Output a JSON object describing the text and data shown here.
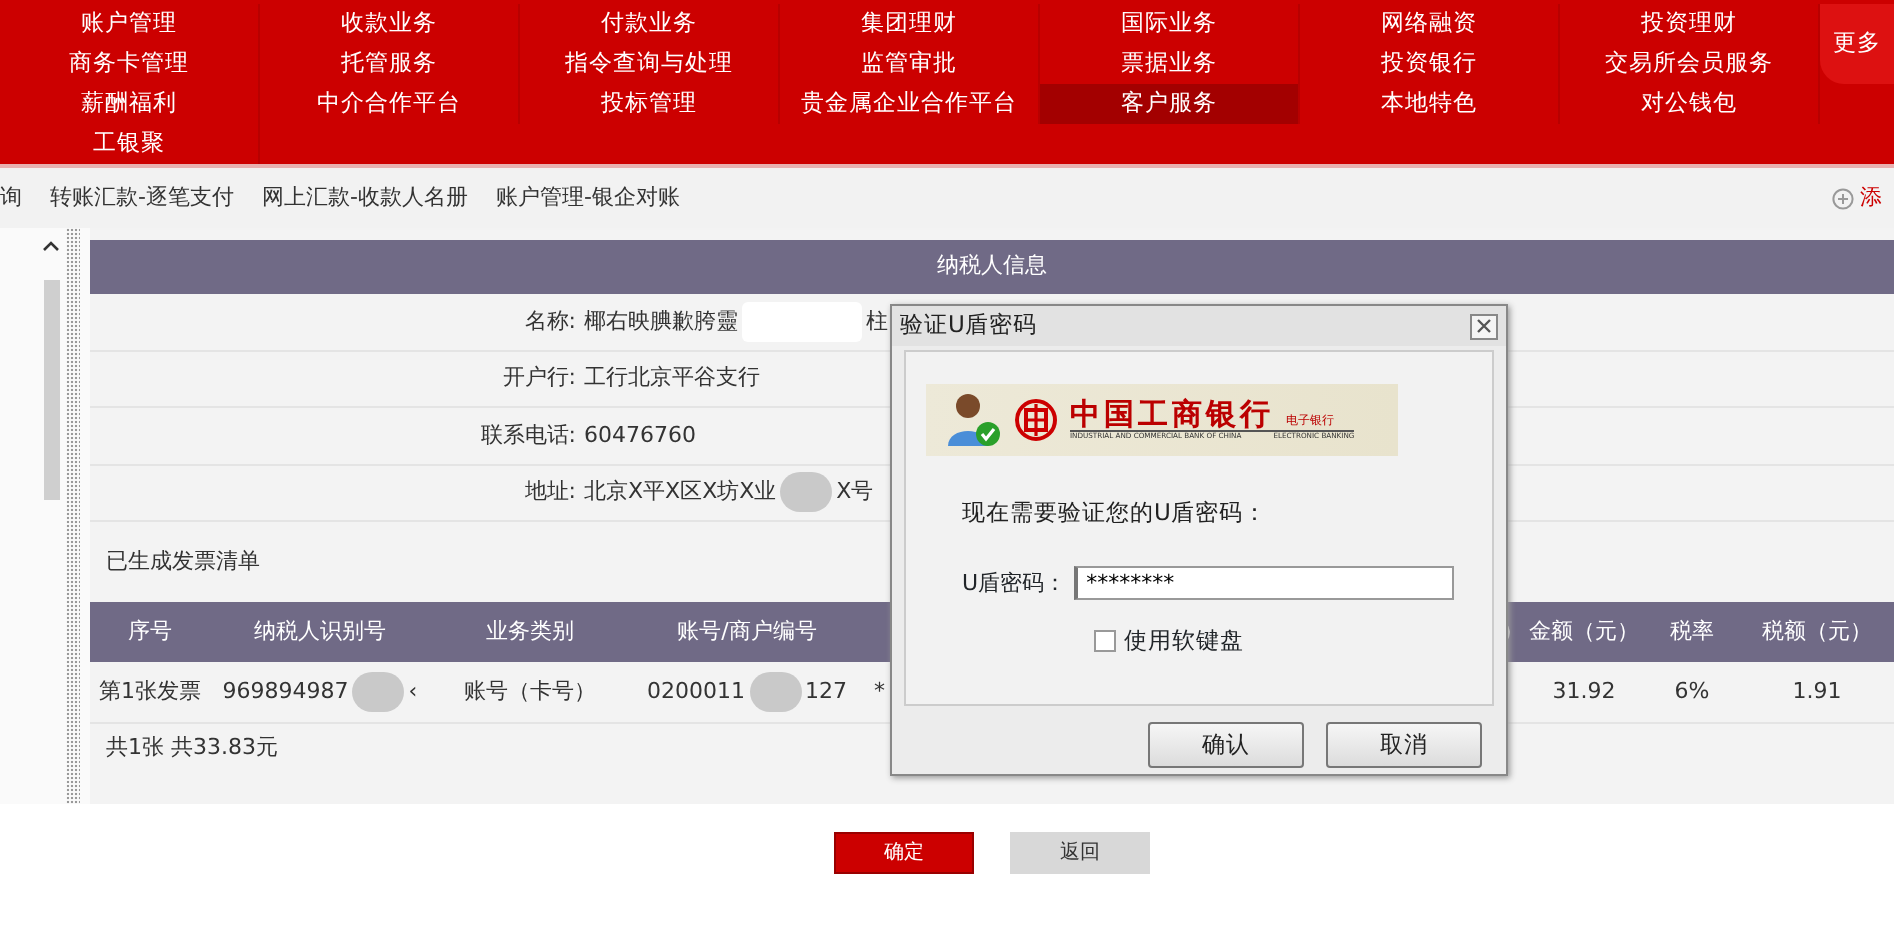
{
  "menu": {
    "items": [
      {
        "label": "账户管理",
        "selected": false
      },
      {
        "label": "收款业务",
        "selected": false
      },
      {
        "label": "付款业务",
        "selected": false
      },
      {
        "label": "集团理财",
        "selected": false
      },
      {
        "label": "国际业务",
        "selected": false
      },
      {
        "label": "网络融资",
        "selected": false
      },
      {
        "label": "投资理财",
        "selected": false
      },
      {
        "label": "商务卡管理",
        "selected": false
      },
      {
        "label": "托管服务",
        "selected": false
      },
      {
        "label": "指令查询与处理",
        "selected": false
      },
      {
        "label": "监管审批",
        "selected": false
      },
      {
        "label": "票据业务",
        "selected": false
      },
      {
        "label": "投资银行",
        "selected": false
      },
      {
        "label": "交易所会员服务",
        "selected": false
      },
      {
        "label": "薪酬福利",
        "selected": false
      },
      {
        "label": "中介合作平台",
        "selected": false
      },
      {
        "label": "投标管理",
        "selected": false
      },
      {
        "label": "贵金属企业合作平台",
        "selected": false
      },
      {
        "label": "客户服务",
        "selected": true
      },
      {
        "label": "本地特色",
        "selected": false
      },
      {
        "label": "对公钱包",
        "selected": false
      },
      {
        "label": "工银聚",
        "selected": false
      }
    ],
    "more": "更多"
  },
  "breadcrumbs": [
    "询",
    "转账汇款-逐笔支付",
    "网上汇款-收款人名册",
    "账户管理-银企对账"
  ],
  "add_link": "添",
  "taxpayer": {
    "title": "纳税人信息",
    "fields": [
      {
        "label": "名称:",
        "parts": [
          "椰右映腆歉胯靈",
          "柱"
        ]
      },
      {
        "label": "开户行:",
        "parts": [
          "工行北京平谷支行"
        ]
      },
      {
        "label": "联系电话:",
        "parts": [
          "60476760"
        ]
      },
      {
        "label": "地址:",
        "parts": [
          "北京X平X区X坊X业",
          "X号"
        ]
      }
    ]
  },
  "invoice_list": {
    "title": "已生成发票清单",
    "columns": [
      "序号",
      "纳税人识别号",
      "业务类别",
      "账号/商户编号",
      "",
      "）",
      "金额（元）",
      "税率",
      "税额（元）"
    ],
    "rows": [
      [
        [
          "第1张发票"
        ],
        [
          "969894987",
          "‹"
        ],
        [
          "账号（卡号）"
        ],
        [
          "0200011",
          "127"
        ],
        [
          "*"
        ],
        [
          ""
        ],
        [
          "31.92"
        ],
        [
          "6%"
        ],
        [
          "1.91"
        ]
      ]
    ],
    "total": "共1张 共33.83元"
  },
  "actions": {
    "confirm": "确定",
    "back": "返回"
  },
  "dialog": {
    "title": "验证U盾密码",
    "bank_name": "中国工商银行",
    "bank_tag": "电子银行",
    "bank_name_en": "INDUSTRIAL AND COMMERCIAL BANK OF CHINA",
    "bank_tag_en": "ELECTRONIC BANKING",
    "prompt": "现在需要验证您的U盾密码：",
    "password_label": "U盾密码：",
    "password_value": "********",
    "soft_keyboard": {
      "label": "使用软键盘",
      "checked": false
    },
    "buttons": [
      "确认",
      "取消"
    ]
  }
}
